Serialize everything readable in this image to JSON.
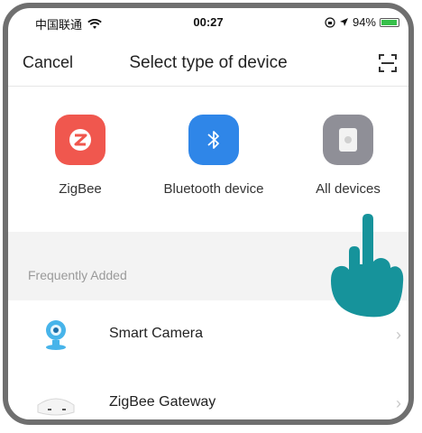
{
  "status_bar": {
    "carrier": "中国联通",
    "time": "00:27",
    "battery_percent": "94%",
    "battery_level": 0.94
  },
  "nav": {
    "cancel_label": "Cancel",
    "title": "Select type of device",
    "scan_icon": "scan-icon"
  },
  "device_types": [
    {
      "label": "ZigBee",
      "icon": "zigbee-icon",
      "color": "#f0574e"
    },
    {
      "label": "Bluetooth device",
      "icon": "bluetooth-icon",
      "color": "#2f86e8"
    },
    {
      "label": "All devices",
      "icon": "all-devices-icon",
      "color": "#8f8f97"
    }
  ],
  "frequently_added": {
    "title": "Frequently Added",
    "items": [
      {
        "name": "Smart Camera",
        "icon": "camera-icon"
      },
      {
        "name": "ZigBee Gateway",
        "icon": "gateway-icon"
      }
    ]
  },
  "colors": {
    "hand_pointer": "#16939b",
    "section_background": "#f3f3f3"
  }
}
